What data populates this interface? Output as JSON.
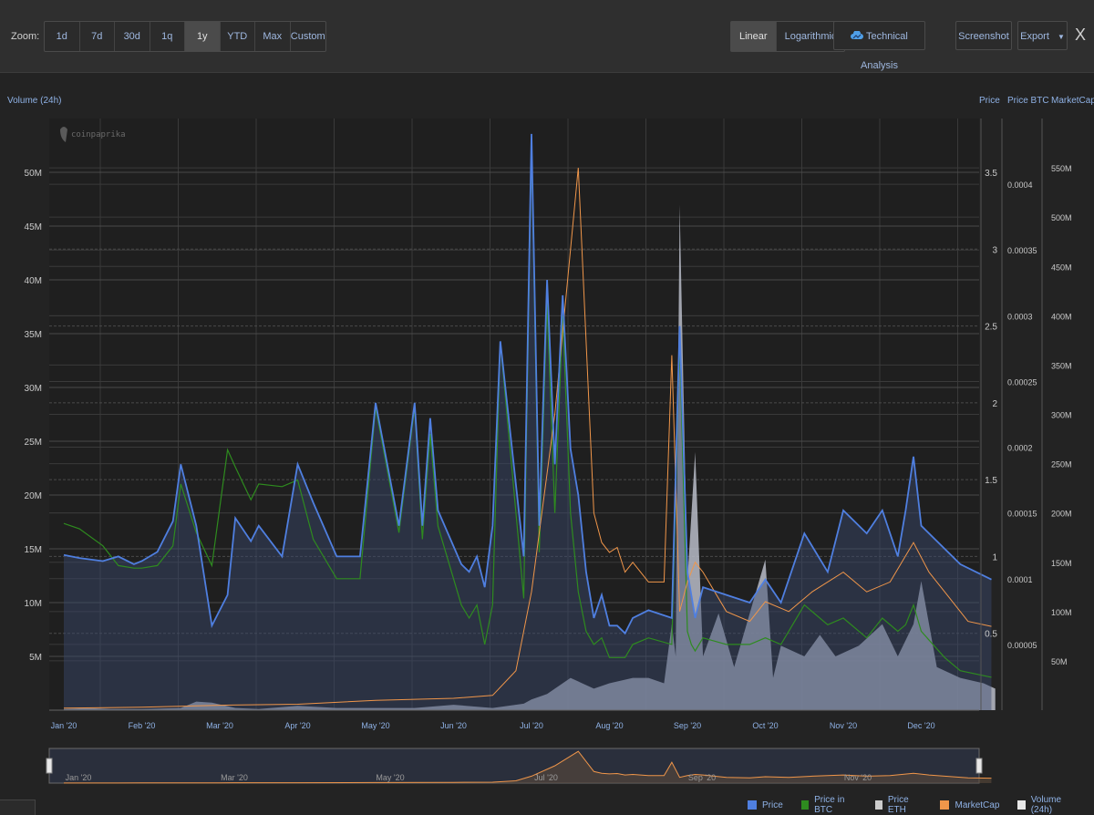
{
  "toolbar": {
    "zoom_label": "Zoom:",
    "zoom_buttons": [
      "1d",
      "7d",
      "30d",
      "1q",
      "1y",
      "YTD",
      "Max",
      "Custom"
    ],
    "zoom_active": "1y",
    "scale_buttons": [
      "Linear",
      "Logarithmic"
    ],
    "scale_active": "Linear",
    "technical_analysis": "Technical Analysis",
    "screenshot": "Screenshot",
    "export": "Export",
    "close": "X"
  },
  "watermark": "coinpaprika",
  "legend": [
    {
      "label": "Price",
      "color": "#4f7fe0"
    },
    {
      "label": "Price in BTC",
      "color": "#2e8b1f"
    },
    {
      "label": "Price ETH",
      "color": "#cccccc"
    },
    {
      "label": "MarketCap",
      "color": "#f0964a"
    },
    {
      "label": "Volume (24h)",
      "color": "#e8e8e8"
    }
  ],
  "chart_data": {
    "type": "line",
    "x_labels": [
      "Jan '20",
      "Feb '20",
      "Mar '20",
      "Apr '20",
      "May '20",
      "Jun '20",
      "Jul '20",
      "Aug '20",
      "Sep '20",
      "Oct '20",
      "Nov '20",
      "Dec '20"
    ],
    "navigator_labels": [
      "Jan '20",
      "Mar '20",
      "May '20",
      "Jul '20",
      "Sep '20",
      "Nov '20"
    ],
    "axes": {
      "volume": {
        "title": "Volume (24h)",
        "range": [
          0,
          55000000
        ],
        "ticks": [
          5000000,
          10000000,
          15000000,
          20000000,
          25000000,
          30000000,
          35000000,
          40000000,
          45000000,
          50000000
        ],
        "tick_labels": [
          "5M",
          "10M",
          "15M",
          "20M",
          "25M",
          "30M",
          "35M",
          "40M",
          "45M",
          "50M"
        ]
      },
      "price": {
        "title": "Price",
        "range": [
          0,
          3.85
        ],
        "ticks": [
          0.5,
          1,
          1.5,
          2,
          2.5,
          3,
          3.5
        ],
        "tick_labels": [
          "0.5",
          "1",
          "1.5",
          "2",
          "2.5",
          "3",
          "3.5"
        ]
      },
      "price_btc": {
        "title": "Price BTC",
        "range": [
          0,
          0.00045
        ],
        "ticks": [
          5e-05,
          0.0001,
          0.00015,
          0.0002,
          0.00025,
          0.0003,
          0.00035,
          0.0004
        ],
        "tick_labels": [
          "0.00005",
          "0.0001",
          "0.00015",
          "0.0002",
          "0.00025",
          "0.0003",
          "0.00035",
          "0.0004"
        ]
      },
      "marketcap": {
        "title": "MarketCap",
        "range": [
          0,
          600000000
        ],
        "ticks": [
          50000000,
          100000000,
          150000000,
          200000000,
          250000000,
          300000000,
          350000000,
          400000000,
          450000000,
          500000000,
          550000000
        ],
        "tick_labels": [
          "50M",
          "100M",
          "150M",
          "200M",
          "250M",
          "300M",
          "350M",
          "400M",
          "450M",
          "500M",
          "550M"
        ]
      }
    },
    "series": [
      {
        "name": "Price",
        "axis": "price",
        "color": "#4f7fe0",
        "x": [
          0,
          0.2,
          0.5,
          0.7,
          0.9,
          1.0,
          1.2,
          1.4,
          1.5,
          1.7,
          1.9,
          2.1,
          2.2,
          2.4,
          2.5,
          2.8,
          3.0,
          3.2,
          3.5,
          3.8,
          4.0,
          4.3,
          4.5,
          4.6,
          4.7,
          4.8,
          5.1,
          5.2,
          5.3,
          5.4,
          5.5,
          5.6,
          5.9,
          6.0,
          6.1,
          6.2,
          6.3,
          6.4,
          6.5,
          6.6,
          6.7,
          6.8,
          6.9,
          7.0,
          7.1,
          7.2,
          7.3,
          7.5,
          7.8,
          7.9,
          8.0,
          8.05,
          8.1,
          8.2,
          8.5,
          8.8,
          9.0,
          9.2,
          9.5,
          9.8,
          10.0,
          10.3,
          10.5,
          10.7,
          10.8,
          10.9,
          11.0,
          11.3,
          11.5,
          11.9
        ],
        "y": [
          1.01,
          0.99,
          0.97,
          1.0,
          0.95,
          0.97,
          1.03,
          1.23,
          1.6,
          1.2,
          0.55,
          0.75,
          1.25,
          1.1,
          1.2,
          1.0,
          1.6,
          1.35,
          1.0,
          1.0,
          2.0,
          1.2,
          2.0,
          1.2,
          1.9,
          1.3,
          0.95,
          0.9,
          1.0,
          0.8,
          1.2,
          2.4,
          1.0,
          3.75,
          1.2,
          2.8,
          1.6,
          2.7,
          1.7,
          1.4,
          0.9,
          0.6,
          0.75,
          0.55,
          0.55,
          0.5,
          0.6,
          0.65,
          0.6,
          2.5,
          0.9,
          0.75,
          0.6,
          0.8,
          0.75,
          0.7,
          0.85,
          0.7,
          1.15,
          0.9,
          1.3,
          1.15,
          1.3,
          1.0,
          1.3,
          1.65,
          1.2,
          1.05,
          0.95,
          0.85
        ]
      },
      {
        "name": "Price in BTC",
        "axis": "price_btc",
        "color": "#2e8b1f",
        "x": [
          0,
          0.2,
          0.5,
          0.7,
          0.9,
          1.0,
          1.2,
          1.4,
          1.5,
          1.7,
          1.9,
          2.1,
          2.2,
          2.4,
          2.5,
          2.8,
          3.0,
          3.2,
          3.5,
          3.8,
          4.0,
          4.3,
          4.5,
          4.6,
          4.7,
          4.8,
          5.1,
          5.2,
          5.3,
          5.4,
          5.5,
          5.6,
          5.9,
          6.0,
          6.1,
          6.2,
          6.3,
          6.4,
          6.5,
          6.6,
          6.7,
          6.8,
          6.9,
          7.0,
          7.1,
          7.2,
          7.3,
          7.5,
          7.8,
          7.9,
          8.0,
          8.05,
          8.1,
          8.2,
          8.5,
          8.8,
          9.0,
          9.2,
          9.5,
          9.8,
          10.0,
          10.3,
          10.5,
          10.7,
          10.8,
          10.9,
          11.0,
          11.3,
          11.5,
          11.9
        ],
        "y": [
          0.000142,
          0.000138,
          0.000125,
          0.00011,
          0.000108,
          0.000108,
          0.00011,
          0.000125,
          0.000172,
          0.000135,
          0.00011,
          0.000198,
          0.000185,
          0.00016,
          0.000172,
          0.00017,
          0.000175,
          0.00013,
          0.0001,
          0.0001,
          0.00023,
          0.000135,
          0.00023,
          0.00013,
          0.00021,
          0.00014,
          8e-05,
          7e-05,
          8e-05,
          5e-05,
          8e-05,
          0.00028,
          8.5e-05,
          0.00043,
          0.00012,
          0.00031,
          0.00015,
          0.0003,
          0.00015,
          9e-05,
          6e-05,
          5e-05,
          5.5e-05,
          4e-05,
          4e-05,
          4e-05,
          5e-05,
          5.5e-05,
          5e-05,
          0.00028,
          6e-05,
          5e-05,
          4.5e-05,
          5.5e-05,
          5e-05,
          5e-05,
          5.5e-05,
          5e-05,
          8e-05,
          6.5e-05,
          7e-05,
          5.5e-05,
          7e-05,
          6e-05,
          6.5e-05,
          8e-05,
          6e-05,
          4e-05,
          3e-05,
          2.5e-05
        ]
      },
      {
        "name": "MarketCap",
        "axis": "marketcap",
        "color": "#f0964a",
        "x": [
          0,
          1,
          2,
          3,
          4,
          5,
          5.5,
          5.8,
          6.0,
          6.3,
          6.6,
          6.8,
          6.9,
          7.0,
          7.1,
          7.2,
          7.3,
          7.5,
          7.7,
          7.8,
          7.9,
          8.0,
          8.1,
          8.2,
          8.5,
          8.8,
          9.0,
          9.3,
          9.6,
          10.0,
          10.3,
          10.6,
          10.9,
          11.1,
          11.3,
          11.6,
          11.9
        ],
        "y": [
          2000000,
          3000000,
          5000000,
          6000000,
          10000000,
          12000000,
          15000000,
          40000000,
          120000000,
          300000000,
          550000000,
          200000000,
          170000000,
          160000000,
          165000000,
          140000000,
          150000000,
          130000000,
          130000000,
          360000000,
          100000000,
          130000000,
          150000000,
          140000000,
          100000000,
          90000000,
          110000000,
          100000000,
          120000000,
          140000000,
          120000000,
          130000000,
          170000000,
          140000000,
          120000000,
          90000000,
          85000000
        ]
      },
      {
        "name": "Volume (24h)",
        "axis": "volume",
        "color": "#e8e8e8",
        "x": [
          0,
          0.3,
          0.6,
          1.0,
          1.5,
          1.7,
          1.9,
          2.2,
          2.5,
          3.0,
          3.5,
          4.0,
          4.5,
          5.0,
          5.5,
          5.9,
          6.0,
          6.2,
          6.5,
          6.8,
          7.0,
          7.3,
          7.5,
          7.7,
          7.8,
          7.85,
          7.9,
          8.0,
          8.1,
          8.2,
          8.4,
          8.6,
          8.8,
          9.0,
          9.1,
          9.2,
          9.5,
          9.7,
          9.9,
          10.2,
          10.5,
          10.7,
          10.9,
          11.0,
          11.2,
          11.5,
          11.8,
          11.95
        ],
        "y": [
          100000,
          200000,
          100000,
          100000,
          200000,
          800000,
          700000,
          200000,
          100000,
          400000,
          200000,
          200000,
          200000,
          500000,
          200000,
          600000,
          1000000,
          1500000,
          3000000,
          2000000,
          2500000,
          3000000,
          3000000,
          2500000,
          8000000,
          5000000,
          47000000,
          12000000,
          24000000,
          5000000,
          9000000,
          4000000,
          9000000,
          14000000,
          3000000,
          6000000,
          5000000,
          7000000,
          5000000,
          6000000,
          8000000,
          5000000,
          8000000,
          12000000,
          4000000,
          3000000,
          2500000,
          2000000
        ]
      }
    ],
    "grid": true
  }
}
